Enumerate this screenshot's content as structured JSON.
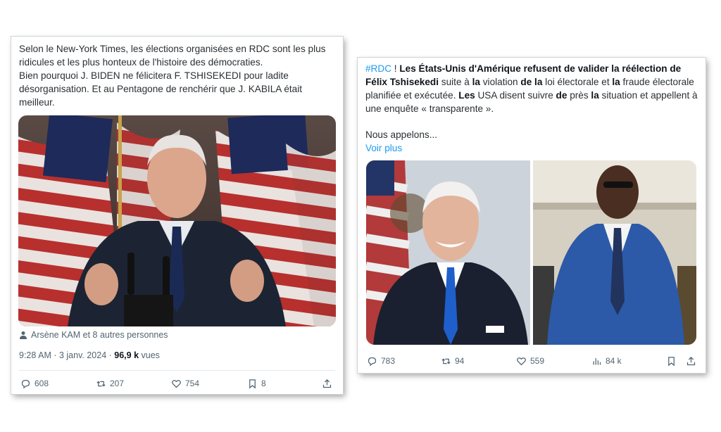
{
  "tweet1": {
    "text_lines": [
      "Selon le New-York Times, les élections organisées en RDC sont les plus ridicules et les plus honteux de l'histoire des démocraties.",
      "Bien pourquoi J. BIDEN ne félicitera   F. TSHISEKEDI pour ladite désorganisation. Et au Pentagone de renchérir que J. KABILA était meilleur."
    ],
    "tagged": "Arsène KAM et 8 autres personnes",
    "time": "9:28 AM · 3 janv. 2024 · ",
    "views_count": "96,9 k",
    "views_label": "vues",
    "actions": {
      "replies": "608",
      "retweets": "207",
      "likes": "754",
      "bookmarks": "8"
    }
  },
  "tweet2": {
    "hashtag": "#RDC",
    "headline_1": " ! ",
    "headline_bold_1": "Les États-Unis d'Amérique refusent de valider la réélection de Félix Tshisekedi",
    "seg_1": " suite à ",
    "bold_la_1": "la",
    "seg_2": " violation ",
    "bold_de_la": "de la",
    "seg_3": " loi électorale et ",
    "bold_la_2": "la",
    "seg_4": " fraude électorale planifiée et exécutée. ",
    "bold_les": "Les",
    "seg_5": " USA disent suivre ",
    "bold_de": "de",
    "seg_6": " près ",
    "bold_la_3": "la",
    "seg_7": " situation et appellent à une enquête « transparente ».",
    "second_para": "Nous appelons...",
    "voir_plus": "Voir plus",
    "actions": {
      "replies": "783",
      "retweets": "94",
      "likes": "559",
      "views": "84 k"
    }
  },
  "colors": {
    "link": "#1d9bf0",
    "secondary_text": "#536471",
    "divider": "#e6e8ea"
  },
  "icons": [
    "reply-icon",
    "retweet-icon",
    "like-icon",
    "bookmark-icon",
    "share-icon",
    "views-icon",
    "person-icon"
  ]
}
